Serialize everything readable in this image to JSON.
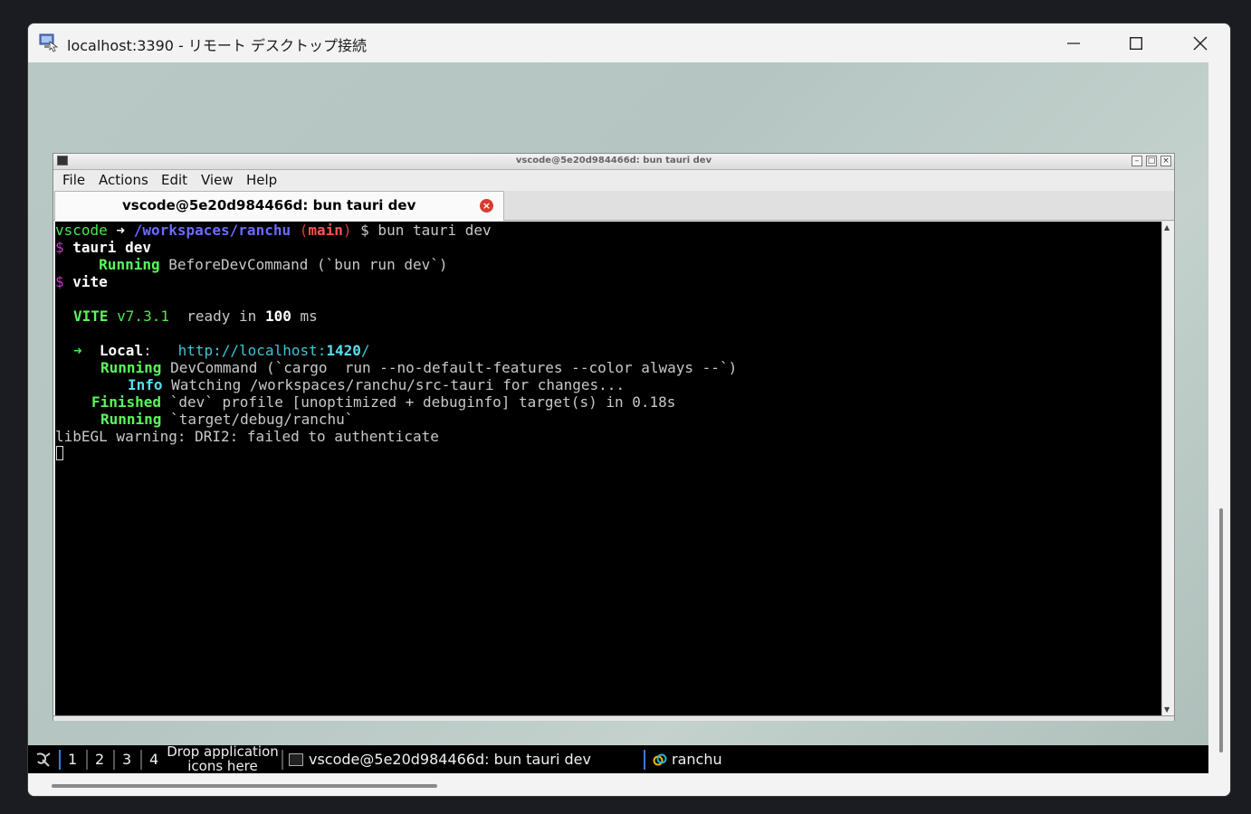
{
  "rdp": {
    "title": "localhost:3390 - リモート デスクトップ接続",
    "minimize_icon": "minimize-icon",
    "maximize_icon": "maximize-icon",
    "close_icon": "close-icon"
  },
  "terminal": {
    "title": "vscode@5e20d984466d: bun tauri dev",
    "menu": [
      "File",
      "Actions",
      "Edit",
      "View",
      "Help"
    ],
    "tab_label": "vscode@5e20d984466d: bun tauri dev",
    "lines": {
      "l1_user": "vscode",
      "l1_arrow": " ➜ ",
      "l1_path": "/workspaces/ranchu",
      "l1_paren_open": " (",
      "l1_branch": "main",
      "l1_paren_close": ")",
      "l1_cmd": " $ bun tauri dev",
      "l2_prompt": "$",
      "l2_cmd": " tauri dev",
      "l3_indent": "     ",
      "l3_status": "Running",
      "l3_text": " BeforeDevCommand (`bun run dev`)",
      "l4_prompt": "$",
      "l4_cmd": " vite",
      "l6_vite": "VITE",
      "l6_ver": " v7.3.1",
      "l6_ready": "  ready in ",
      "l6_ms_num": "100",
      "l6_ms": " ms",
      "l8_arrow": "➜",
      "l8_local": "  Local",
      "l8_colon": ":   ",
      "l8_url_pre": "http://localhost:",
      "l8_port": "1420",
      "l8_slash": "/",
      "l9_status": "Running",
      "l9_text": " DevCommand (`cargo  run --no-default-features --color always --`)",
      "l10_status": "Info",
      "l10_text": " Watching /workspaces/ranchu/src-tauri for changes...",
      "l11_status": "Finished",
      "l11_text": " `dev` profile [unoptimized + debuginfo] target(s) in 0.18s",
      "l12_status": "Running",
      "l12_text": " `target/debug/ranchu`",
      "l13_text": "libEGL warning: DRI2: failed to authenticate"
    }
  },
  "taskbar": {
    "workspaces": [
      "1",
      "2",
      "3",
      "4"
    ],
    "drop_text": "Drop application icons here",
    "task1_label": "vscode@5e20d984466d: bun tauri dev",
    "task2_label": "ranchu"
  }
}
